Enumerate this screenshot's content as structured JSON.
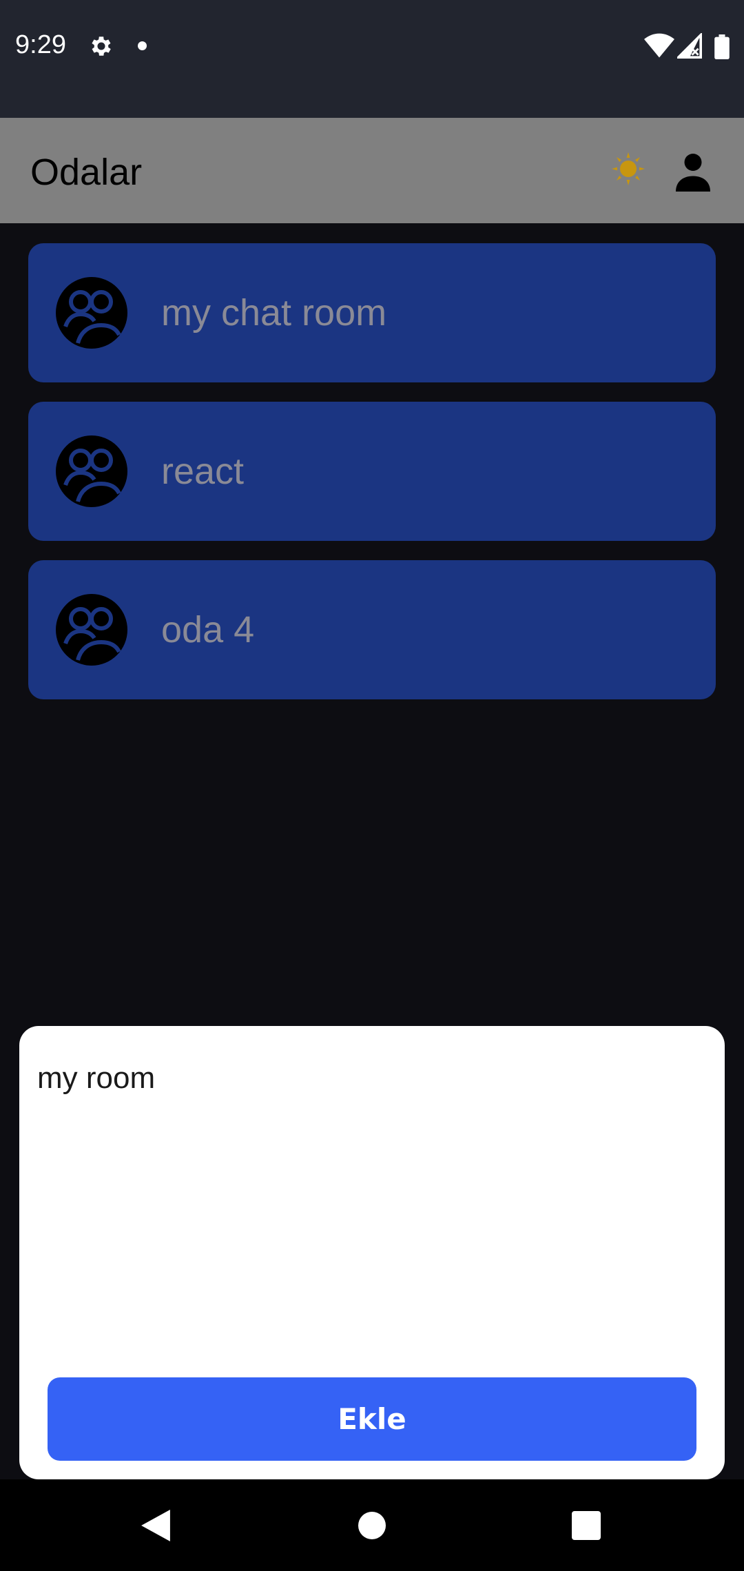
{
  "status_bar": {
    "time": "9:29",
    "icons": [
      "gear-icon",
      "notification-dot-icon",
      "wifi-icon",
      "signal-icon",
      "battery-icon"
    ]
  },
  "app_bar": {
    "title": "Odalar",
    "theme_icon": "sun-icon",
    "profile_icon": "person-icon"
  },
  "rooms": [
    {
      "name": "my chat room",
      "icon": "group-icon"
    },
    {
      "name": "react",
      "icon": "group-icon"
    },
    {
      "name": "oda 4",
      "icon": "group-icon"
    }
  ],
  "add_room_sheet": {
    "input_value": "my room",
    "button_label": "Ekle"
  },
  "colors": {
    "status_bar": "#22252f",
    "app_bar": "#808080",
    "background": "#0d0d12",
    "room_card": "#1b3582",
    "room_text": "#8a8a96",
    "button": "#3562f5",
    "sun": "#c8960f"
  },
  "nav_bar": {
    "icons": [
      "back-icon",
      "home-icon",
      "recents-icon"
    ]
  }
}
